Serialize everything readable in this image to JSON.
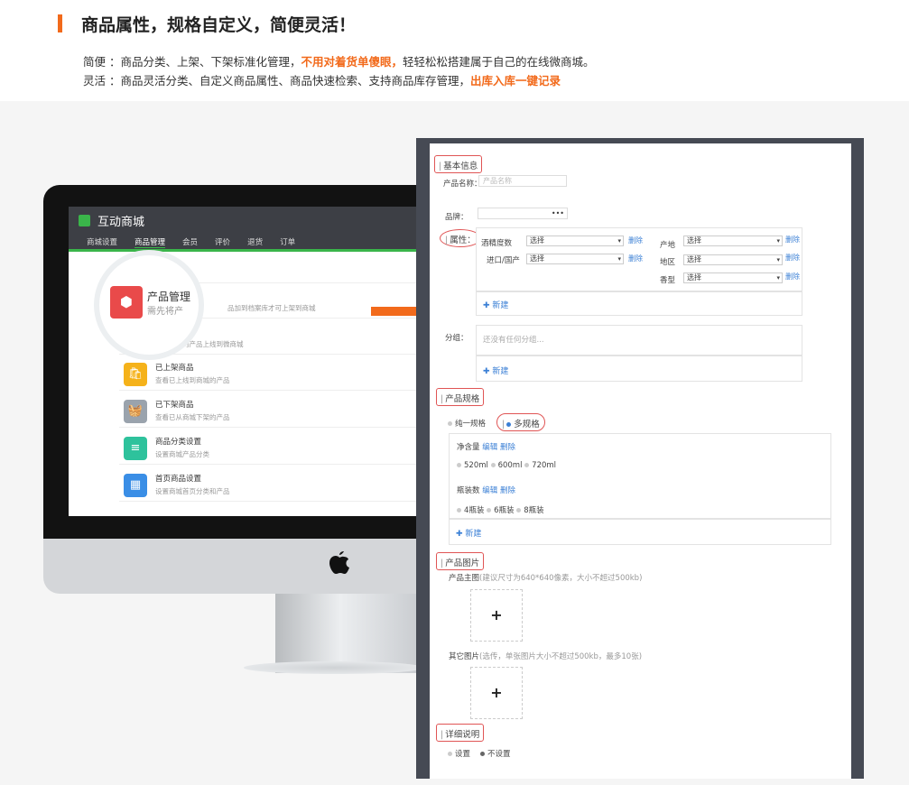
{
  "header": {
    "title": "商品属性，规格自定义，简便灵活！",
    "line1": {
      "pre": "简便 ：商品分类、上架、下架标准化管理，",
      "highlight": "不用对着货单傻眼，",
      "post": "轻轻松松搭建属于自己的在线微商城。"
    },
    "line2": {
      "pre": "灵活 ：商品灵活分类、自定义商品属性、商品快速检索、支持商品库存管理，",
      "highlight": "出库入库一键记录"
    }
  },
  "app": {
    "name": "互动商城",
    "nav": [
      "商城设置",
      "商品管理",
      "会员",
      "评价",
      "退货",
      "订单"
    ],
    "product_manage": {
      "title": "产品管理",
      "subtitle": "需先将产",
      "subtitle_tail": "品加到档案库才可上架到商城"
    },
    "rows": [
      {
        "title": "",
        "sub": "产品库中的产品上线到微商城",
        "color": "#e94a4a",
        "icon": "🛒"
      },
      {
        "title": "已上架商品",
        "sub": "查看已上线到商城的产品",
        "color": "#f5b21a",
        "icon": "🛍"
      },
      {
        "title": "已下架商品",
        "sub": "查看已从商城下架的产品",
        "color": "#9aa3ad",
        "icon": "🧺"
      },
      {
        "title": "商品分类设置",
        "sub": "设置商城产品分类",
        "color": "#2ec29c",
        "icon": "≡"
      },
      {
        "title": "首页商品设置",
        "sub": "设置商城首页分类和产品",
        "color": "#3a8ee6",
        "icon": "▦"
      }
    ]
  },
  "form": {
    "basic_info": "基本信息",
    "product_name_label": "产品名称：",
    "product_name_placeholder": "产品名称",
    "brand_label": "品牌：",
    "brand_value": "•••",
    "attr_label": "属性：",
    "attrs_left": [
      {
        "label": "酒精度数",
        "value": "选择"
      },
      {
        "label": "进口/国产",
        "value": "选择"
      }
    ],
    "attrs_right": [
      {
        "label": "产地",
        "value": "选择"
      },
      {
        "label": "地区",
        "value": "选择"
      },
      {
        "label": "香型",
        "value": "选择"
      }
    ],
    "delete": "删除",
    "add_new": "新建",
    "group_label": "分组：",
    "group_placeholder": "还没有任何分组...",
    "spec_section": "产品规格",
    "spec_single": "纯一规格",
    "spec_multi": "多规格",
    "spec_groups": [
      {
        "name": "净含量",
        "edit": "编辑",
        "del": "删除",
        "values": [
          "520ml",
          "600ml",
          "720ml"
        ]
      },
      {
        "name": "瓶装数",
        "edit": "编辑",
        "del": "删除",
        "values": [
          "4瓶装",
          "6瓶装",
          "8瓶装"
        ]
      }
    ],
    "image_section": "产品图片",
    "main_image": "产品主图",
    "main_image_hint": "(建议尺寸为640*640像素，大小不超过500kb)",
    "other_image": "其它图片",
    "other_image_hint": "(选传，单张图片大小不超过500kb，最多10张)",
    "plus": "+",
    "detail_section": "详细说明",
    "detail_set": "设置",
    "detail_unset": "不设置"
  }
}
